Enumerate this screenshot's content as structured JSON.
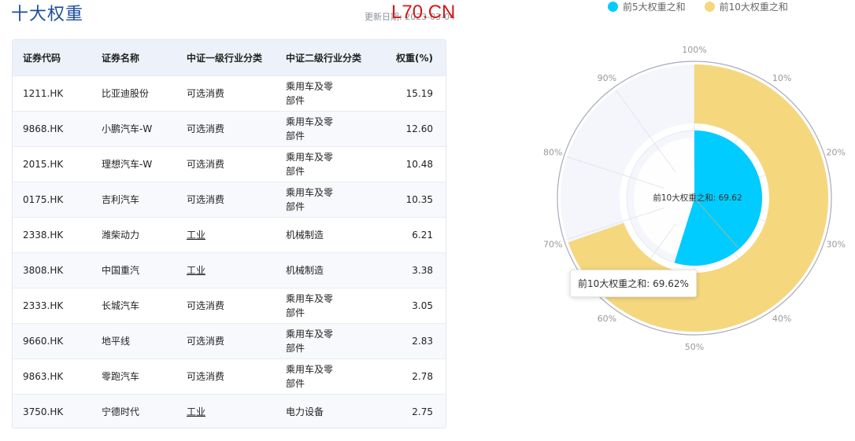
{
  "header": {
    "title": "十大权重",
    "update_text": "更新日期: 2023-03-04",
    "watermark": "L70.CN"
  },
  "table": {
    "columns": [
      "证券代码",
      "证券名称",
      "中证一级行业分类",
      "中证二级行业分类",
      "权重(%)"
    ],
    "rows": [
      {
        "code": "1211.HK",
        "name": "比亚迪股份",
        "ind1": "可选消费",
        "ind2": "乘用车及零部件",
        "weight": "15.19"
      },
      {
        "code": "9868.HK",
        "name": "小鹏汽车-W",
        "ind1": "可选消费",
        "ind2": "乘用车及零部件",
        "weight": "12.60"
      },
      {
        "code": "2015.HK",
        "name": "理想汽车-W",
        "ind1": "可选消费",
        "ind2": "乘用车及零部件",
        "weight": "10.48"
      },
      {
        "code": "0175.HK",
        "name": "吉利汽车",
        "ind1": "可选消费",
        "ind2": "乘用车及零部件",
        "weight": "10.35"
      },
      {
        "code": "2338.HK",
        "name": "潍柴动力",
        "ind1": "工业",
        "ind2": "机械制造",
        "weight": "6.21"
      },
      {
        "code": "3808.HK",
        "name": "中国重汽",
        "ind1": "工业",
        "ind2": "机械制造",
        "weight": "3.38"
      },
      {
        "code": "2333.HK",
        "name": "长城汽车",
        "ind1": "可选消费",
        "ind2": "乘用车及零部件",
        "weight": "3.05"
      },
      {
        "code": "9660.HK",
        "name": "地平线",
        "ind1": "可选消费",
        "ind2": "乘用车及零部件",
        "weight": "2.83"
      },
      {
        "code": "9863.HK",
        "name": "零跑汽车",
        "ind1": "可选消费",
        "ind2": "乘用车及零部件",
        "weight": "2.78"
      },
      {
        "code": "3750.HK",
        "name": "宁德时代",
        "ind1": "工业",
        "ind2": "电力设备",
        "weight": "2.75"
      }
    ]
  },
  "legend": [
    {
      "label": "前5大权重之和",
      "color": "#00ccff"
    },
    {
      "label": "前10大权重之和",
      "color": "#f5d77e"
    }
  ],
  "chart_data": {
    "type": "pie",
    "subtype": "polar-percentage-ring",
    "series": [
      {
        "name": "前5大权重之和",
        "value": 54.83,
        "color": "#00ccff"
      },
      {
        "name": "前10大权重之和",
        "value": 69.62,
        "color": "#f5d77e"
      }
    ],
    "angle_axis_ticks": [
      "100%",
      "10%",
      "20%",
      "30%",
      "40%",
      "50%",
      "60%",
      "70%",
      "80%",
      "90%"
    ],
    "angle_axis_max": 100,
    "center_label": "前10大权重之和: 69.62",
    "tooltip": "前10大权重之和: 69.62%"
  }
}
